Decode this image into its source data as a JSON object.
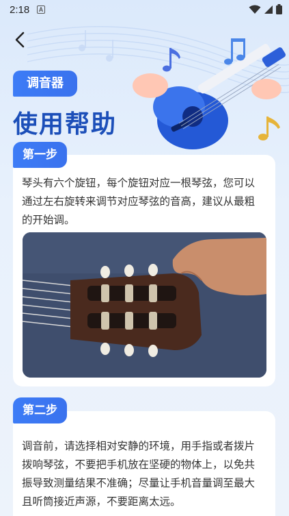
{
  "status": {
    "time": "2:18",
    "badge": "A"
  },
  "header": {
    "tag": "调音器",
    "title": "使用帮助"
  },
  "steps": [
    {
      "label": "第一步",
      "text": "琴头有六个旋钮，每个旋钮对应一根琴弦，您可以通过左右旋转来调节对应琴弦的音高，建议从最粗的开始调。"
    },
    {
      "label": "第二步",
      "text": "调音前，请选择相对安静的环境，用手指或者拨片拨响琴弦，不要把手机放在坚硬的物体上，以免共振导致测量结果不准确；尽量让手机音量调至最大且听筒接近声源，不要距离太远。"
    }
  ],
  "colors": {
    "accent": "#3a76f2",
    "title": "#1c4fb9",
    "background": "#e3eefb"
  },
  "icons": [
    "back-arrow-icon",
    "wifi-icon",
    "signal-icon",
    "battery-icon",
    "music-note-icon"
  ]
}
